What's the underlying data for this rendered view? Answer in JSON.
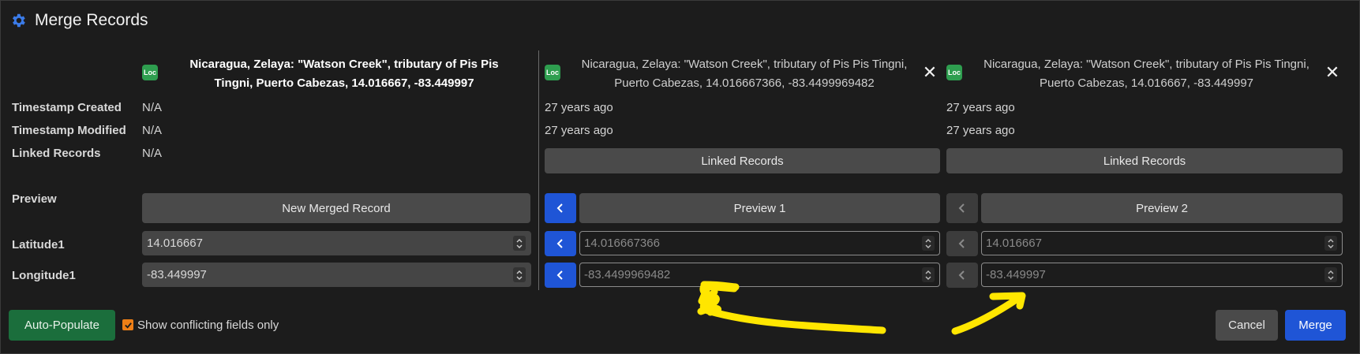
{
  "window": {
    "title": "Merge Records"
  },
  "row_labels": {
    "timestamp_created": "Timestamp Created",
    "timestamp_modified": "Timestamp Modified",
    "linked_records": "Linked Records",
    "preview": "Preview",
    "latitude": "Latitude1",
    "longitude": "Longitude1"
  },
  "merged": {
    "badge": "Loc",
    "header_line1": "Nicaragua, Zelaya: \"Watson Creek\", tributary of Pis Pis",
    "header_line2": "Tingni, Puerto Cabezas, 14.016667, -83.449997",
    "timestamp_created": "N/A",
    "timestamp_modified": "N/A",
    "linked_records": "N/A",
    "preview_button": "New Merged Record",
    "latitude": "14.016667",
    "longitude": "-83.449997"
  },
  "record1": {
    "badge": "Loc",
    "header_line1": "Nicaragua, Zelaya: \"Watson Creek\", tributary of Pis Pis Tingni,",
    "header_line2": "Puerto Cabezas, 14.016667366, -83.4499969482",
    "timestamp_created": "27 years ago",
    "timestamp_modified": "27 years ago",
    "linked_records_button": "Linked Records",
    "preview_button": "Preview 1",
    "latitude": "14.016667366",
    "longitude": "-83.4499969482"
  },
  "record2": {
    "badge": "Loc",
    "header_line1": "Nicaragua, Zelaya: \"Watson Creek\", tributary of Pis Pis Tingni,",
    "header_line2": "Puerto Cabezas, 14.016667, -83.449997",
    "timestamp_created": "27 years ago",
    "timestamp_modified": "27 years ago",
    "linked_records_button": "Linked Records",
    "preview_button": "Preview 2",
    "latitude": "14.016667",
    "longitude": "-83.449997"
  },
  "footer": {
    "auto_populate": "Auto-Populate",
    "show_conflicting": "Show conflicting fields only",
    "cancel": "Cancel",
    "merge": "Merge"
  },
  "colors": {
    "accent_blue": "#1f55d6",
    "auto_green": "#1b6e3c",
    "checkbox_orange": "#ef7f16",
    "badge_green": "#2e9e4f",
    "annotation_yellow": "#ffe600"
  }
}
